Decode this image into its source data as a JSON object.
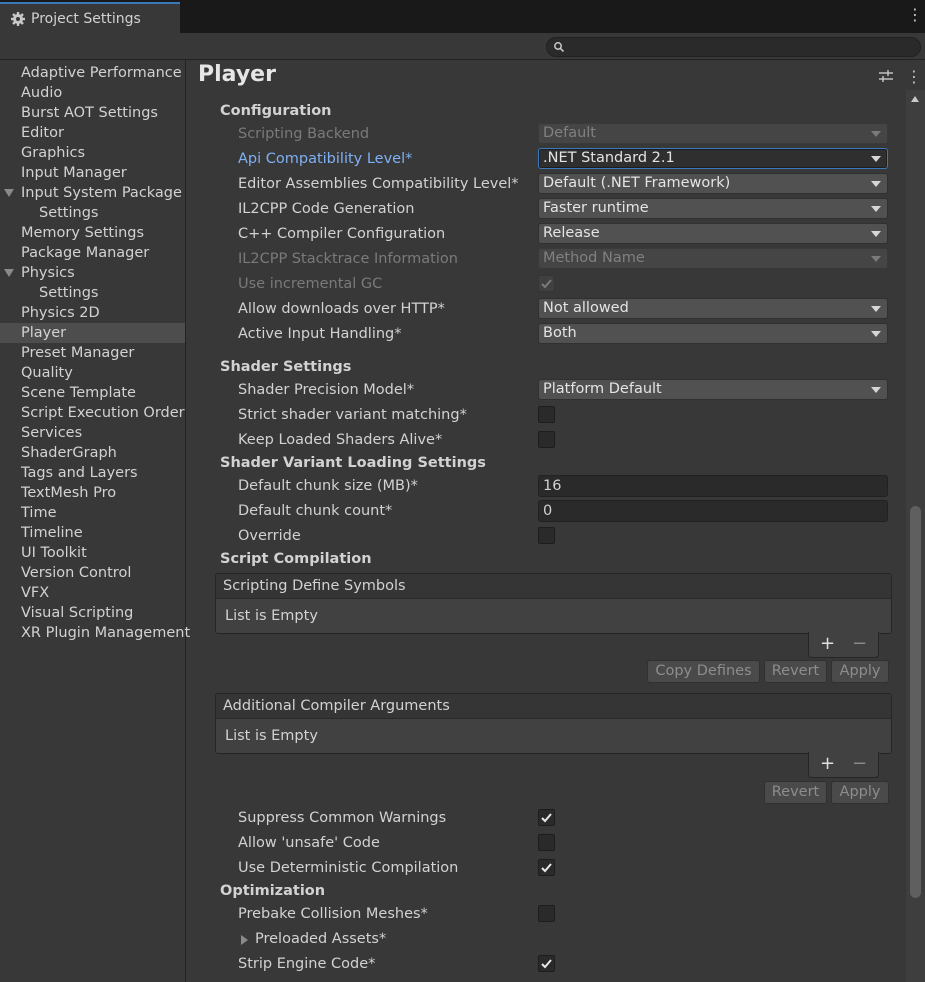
{
  "window": {
    "tab_title": "Project Settings",
    "search_placeholder": ""
  },
  "sidebar": {
    "items": [
      {
        "label": "Adaptive Performance"
      },
      {
        "label": "Audio"
      },
      {
        "label": "Burst AOT Settings"
      },
      {
        "label": "Editor"
      },
      {
        "label": "Graphics"
      },
      {
        "label": "Input Manager"
      },
      {
        "label": "Input System Package"
      },
      {
        "label": "Settings"
      },
      {
        "label": "Memory Settings"
      },
      {
        "label": "Package Manager"
      },
      {
        "label": "Physics"
      },
      {
        "label": "Settings"
      },
      {
        "label": "Physics 2D"
      },
      {
        "label": "Player"
      },
      {
        "label": "Preset Manager"
      },
      {
        "label": "Quality"
      },
      {
        "label": "Scene Template"
      },
      {
        "label": "Script Execution Order"
      },
      {
        "label": "Services"
      },
      {
        "label": "ShaderGraph"
      },
      {
        "label": "Tags and Layers"
      },
      {
        "label": "TextMesh Pro"
      },
      {
        "label": "Time"
      },
      {
        "label": "Timeline"
      },
      {
        "label": "UI Toolkit"
      },
      {
        "label": "Version Control"
      },
      {
        "label": "VFX"
      },
      {
        "label": "Visual Scripting"
      },
      {
        "label": "XR Plugin Management"
      }
    ],
    "selected": "Player"
  },
  "main": {
    "title": "Player",
    "configuration": {
      "heading": "Configuration",
      "scripting_backend": {
        "label": "Scripting Backend",
        "value": "Default"
      },
      "api_compat": {
        "label": "Api Compatibility Level*",
        "value": ".NET Standard 2.1"
      },
      "editor_assemblies": {
        "label": "Editor Assemblies Compatibility Level*",
        "value": "Default (.NET Framework)"
      },
      "il2cpp_codegen": {
        "label": "IL2CPP Code Generation",
        "value": "Faster runtime"
      },
      "cpp_compiler": {
        "label": "C++ Compiler Configuration",
        "value": "Release"
      },
      "il2cpp_stacktrace": {
        "label": "IL2CPP Stacktrace Information",
        "value": "Method Name"
      },
      "incremental_gc": {
        "label": "Use incremental GC",
        "checked": true
      },
      "http_downloads": {
        "label": "Allow downloads over HTTP*",
        "value": "Not allowed"
      },
      "input_handling": {
        "label": "Active Input Handling*",
        "value": "Both"
      }
    },
    "shader_settings": {
      "heading": "Shader Settings",
      "precision_model": {
        "label": "Shader Precision Model*",
        "value": "Platform Default"
      },
      "strict_matching": {
        "label": "Strict shader variant matching*",
        "checked": false
      },
      "keep_loaded": {
        "label": "Keep Loaded Shaders Alive*",
        "checked": false
      }
    },
    "shader_variant_loading": {
      "heading": "Shader Variant Loading Settings",
      "chunk_size": {
        "label": "Default chunk size (MB)*",
        "value": "16"
      },
      "chunk_count": {
        "label": "Default chunk count*",
        "value": "0"
      },
      "override": {
        "label": "Override",
        "checked": false
      }
    },
    "script_compilation": {
      "heading": "Script Compilation",
      "define_symbols": {
        "title": "Scripting Define Symbols",
        "empty": "List is Empty"
      },
      "add": "+",
      "remove": "−",
      "copy_defines": "Copy Defines",
      "revert": "Revert",
      "apply": "Apply",
      "compiler_args": {
        "title": "Additional Compiler Arguments",
        "empty": "List is Empty"
      },
      "suppress_warnings": {
        "label": "Suppress Common Warnings",
        "checked": true
      },
      "allow_unsafe": {
        "label": "Allow 'unsafe' Code",
        "checked": false
      },
      "deterministic": {
        "label": "Use Deterministic Compilation",
        "checked": true
      }
    },
    "optimization": {
      "heading": "Optimization",
      "prebake": {
        "label": "Prebake Collision Meshes*",
        "checked": false
      },
      "preloaded": {
        "label": "Preloaded Assets*"
      },
      "strip_engine": {
        "label": "Strip Engine Code*",
        "checked": true
      }
    }
  }
}
